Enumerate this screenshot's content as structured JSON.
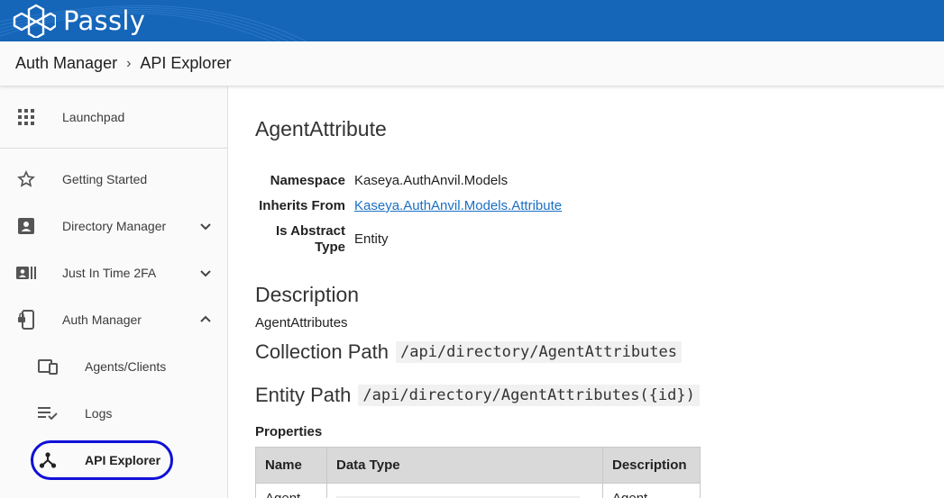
{
  "header": {
    "brand": "Passly",
    "colors": {
      "bar": "#1565b8",
      "active_ring": "#1010d8",
      "link": "#1a6fc4"
    }
  },
  "breadcrumb": {
    "items": [
      "Auth Manager",
      "API Explorer"
    ],
    "separator": "›"
  },
  "sidebar": {
    "items": [
      {
        "label": "Launchpad",
        "icon": "grid-icon"
      },
      {
        "label": "Getting Started",
        "icon": "star-icon"
      },
      {
        "label": "Directory Manager",
        "icon": "contact-card-icon",
        "chevron": "down"
      },
      {
        "label": "Just In Time 2FA",
        "icon": "badge-list-icon",
        "chevron": "down"
      },
      {
        "label": "Auth Manager",
        "icon": "phone-key-icon",
        "chevron": "up"
      },
      {
        "label": "Agents/Clients",
        "icon": "devices-icon"
      },
      {
        "label": "Logs",
        "icon": "list-check-icon"
      },
      {
        "label": "API Explorer",
        "icon": "api-nodes-icon",
        "active": true
      }
    ]
  },
  "main": {
    "title": "AgentAttribute",
    "meta": {
      "namespace_key": "Namespace",
      "namespace_val": "Kaseya.AuthAnvil.Models",
      "inherits_key": "Inherits From",
      "inherits_val": "Kaseya.AuthAnvil.Models.Attribute",
      "abstract_key": "Is Abstract Type",
      "abstract_val": "Entity"
    },
    "description_heading": "Description",
    "description_text": "AgentAttributes",
    "collection_label": "Collection Path",
    "collection_path": "/api/directory/AgentAttributes",
    "entity_label": "Entity Path",
    "entity_path": "/api/directory/AgentAttributes({id})",
    "properties_heading": "Properties",
    "table": {
      "headers": [
        "Name",
        "Data Type",
        "Description"
      ],
      "rows": [
        [
          "Agent",
          "",
          "Agent"
        ]
      ]
    }
  }
}
